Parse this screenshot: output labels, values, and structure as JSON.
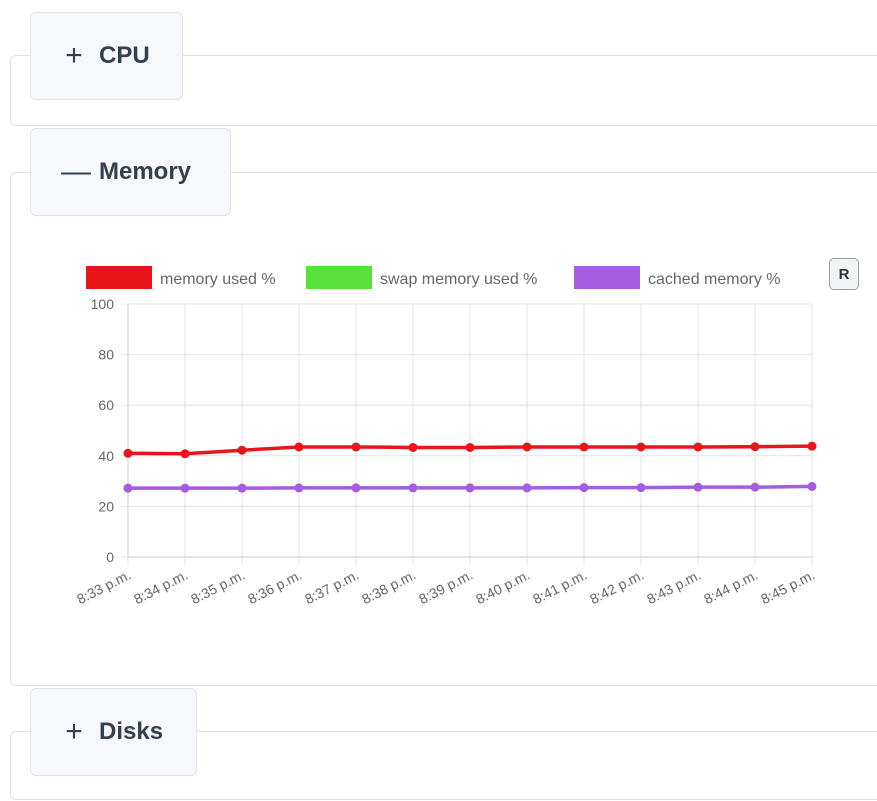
{
  "sections": {
    "cpu": {
      "label": "CPU",
      "toggle_symbol": "+"
    },
    "memory": {
      "label": "Memory",
      "toggle_symbol": "—"
    },
    "disks": {
      "label": "Disks",
      "toggle_symbol": "+"
    }
  },
  "chart_controls": {
    "reset_label": "R"
  },
  "chart_data": {
    "type": "line",
    "x": [
      "8:33 p.m.",
      "8:34 p.m.",
      "8:35 p.m.",
      "8:36 p.m.",
      "8:37 p.m.",
      "8:38 p.m.",
      "8:39 p.m.",
      "8:40 p.m.",
      "8:41 p.m.",
      "8:42 p.m.",
      "8:43 p.m.",
      "8:44 p.m.",
      "8:45 p.m."
    ],
    "ylim": [
      0,
      100
    ],
    "yticks": [
      0,
      20,
      40,
      60,
      80,
      100
    ],
    "grid": true,
    "legend_placement": "top",
    "series": [
      {
        "name": "memory used %",
        "color": "#e8151b",
        "values": [
          41,
          40.8,
          42.2,
          43.5,
          43.5,
          43.3,
          43.3,
          43.5,
          43.5,
          43.5,
          43.5,
          43.6,
          43.8
        ]
      },
      {
        "name": "swap memory used %",
        "color": "#58e03a",
        "values": [
          null,
          null,
          null,
          null,
          null,
          null,
          null,
          null,
          null,
          null,
          null,
          null,
          null
        ]
      },
      {
        "name": "cached memory %",
        "color": "#a55ce0",
        "values": [
          27.2,
          27.2,
          27.2,
          27.3,
          27.3,
          27.3,
          27.3,
          27.3,
          27.4,
          27.4,
          27.6,
          27.6,
          27.9
        ]
      }
    ]
  }
}
